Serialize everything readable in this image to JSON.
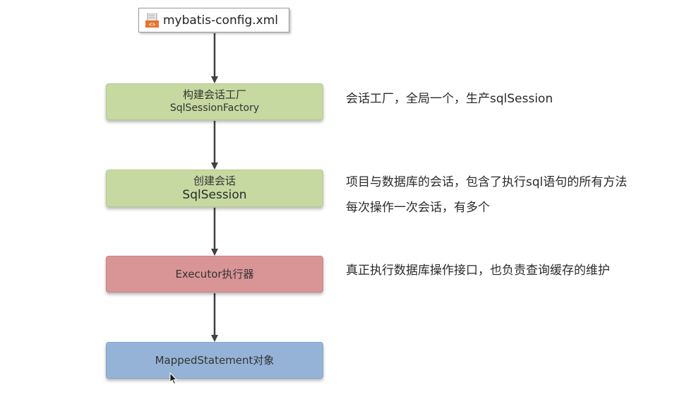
{
  "config_file": {
    "label": "mybatis-config.xml",
    "icon": "xml-file-icon"
  },
  "nodes": [
    {
      "line1": "构建会话工厂",
      "line2": "SqlSessionFactory",
      "color": "#c6d9a0"
    },
    {
      "line1": "创建会话",
      "line2": "SqlSession",
      "color": "#c6d9a0"
    },
    {
      "label": "Executor执行器",
      "color": "#d99496"
    },
    {
      "label": "MappedStatement对象",
      "color": "#95b3d7"
    }
  ],
  "descriptions": {
    "factory": "会话工厂，全局一个，生产sqlSession",
    "session_line1": "项目与数据库的会话，包含了执行sql语句的所有方法",
    "session_line2": "每次操作一次会话，有多个",
    "executor": "真正执行数据库操作接口，也负责查询缓存的维护"
  },
  "colors": {
    "arrow": "#404040",
    "green": "#c6d9a0",
    "red": "#d99496",
    "blue": "#95b3d7"
  }
}
